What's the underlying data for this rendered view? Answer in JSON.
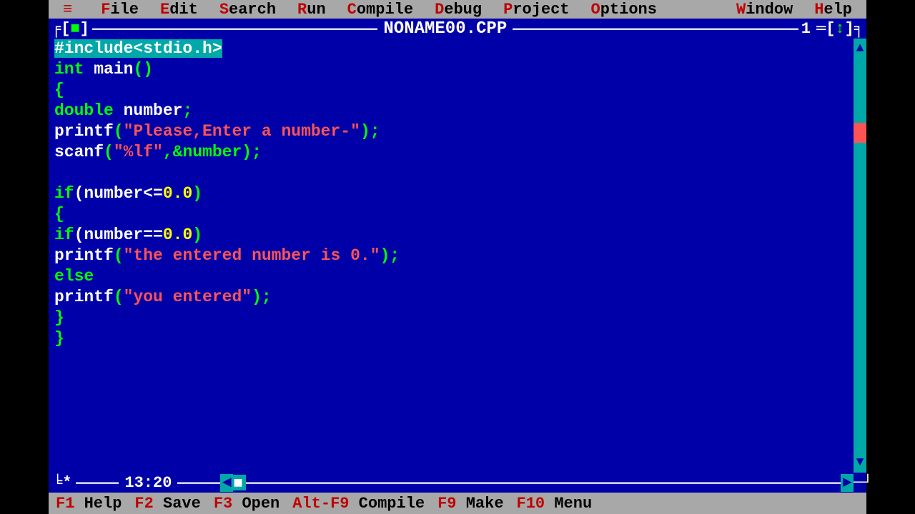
{
  "menu": {
    "items": [
      {
        "hotkey": "F",
        "rest": "ile"
      },
      {
        "hotkey": "E",
        "rest": "dit"
      },
      {
        "hotkey": "S",
        "rest": "earch"
      },
      {
        "hotkey": "R",
        "rest": "un"
      },
      {
        "hotkey": "C",
        "rest": "ompile"
      },
      {
        "hotkey": "D",
        "rest": "ebug"
      },
      {
        "hotkey": "P",
        "rest": "roject"
      },
      {
        "hotkey": "O",
        "rest": "ptions"
      },
      {
        "hotkey": "W",
        "rest": "indow"
      },
      {
        "hotkey": "H",
        "rest": "elp"
      }
    ]
  },
  "window": {
    "title": "NONAME00.CPP",
    "number": "1",
    "cursor_pos": "13:20"
  },
  "code": {
    "line1_highlighted": "#include<stdio.h>",
    "line2_int": "int",
    "line2_main": " main",
    "line2_paren": "()",
    "line3": "{",
    "line4_double": "double",
    "line4_number": " number",
    "line4_semi": ";",
    "line5_printf": "printf",
    "line5_open": "(",
    "line5_str": "\"Please,Enter a number-\"",
    "line5_close": ");",
    "line6_scanf": "scanf",
    "line6_open": "(",
    "line6_str": "\"%lf\"",
    "line6_comma": ",&number);",
    "line8_if": "if",
    "line8_open": "(number<=",
    "line8_zero": "0.0",
    "line8_close": ")",
    "line9": "{",
    "line10_if": "if",
    "line10_open": "(number==",
    "line10_zero": "0.0",
    "line10_close": ")",
    "line11_printf": "printf",
    "line11_open": "(",
    "line11_str": "\"the entered number is 0.\"",
    "line11_close": ");",
    "line12_else": "else",
    "line13_printf": "printf",
    "line13_open": "(",
    "line13_str": "\"you entered\"",
    "line13_close": ");",
    "line14": "}",
    "line15": "}"
  },
  "status": {
    "items": [
      {
        "fkey": "F1",
        "label": " Help"
      },
      {
        "fkey": "F2",
        "label": " Save"
      },
      {
        "fkey": "F3",
        "label": " Open"
      },
      {
        "fkey": "Alt-F9",
        "label": " Compile"
      },
      {
        "fkey": "F9",
        "label": " Make"
      },
      {
        "fkey": "F10",
        "label": " Menu"
      }
    ]
  }
}
